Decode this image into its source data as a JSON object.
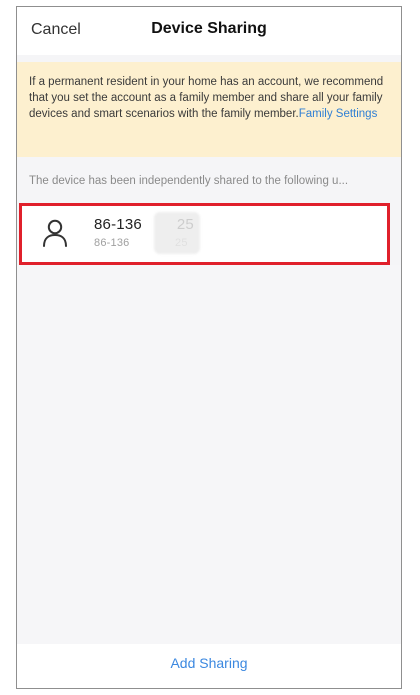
{
  "header": {
    "cancel_label": "Cancel",
    "title": "Device Sharing"
  },
  "notice": {
    "text": "If a permanent resident in your home has an account, we recommend that you set the account as a family member and share all your family devices and smart scenarios with the family member.",
    "link_label": "Family Settings",
    "bg_color": "#fdf0cf",
    "link_color": "#2f7fd4"
  },
  "shared_list": {
    "section_label": "The device has been independently shared to the following u...",
    "users": [
      {
        "icon": "person-icon",
        "primary": "86-136        25",
        "secondary": "86-136              25"
      }
    ],
    "highlight_color": "#e0202b"
  },
  "footer": {
    "add_sharing_label": "Add Sharing",
    "accent_color": "#3b88e0"
  }
}
